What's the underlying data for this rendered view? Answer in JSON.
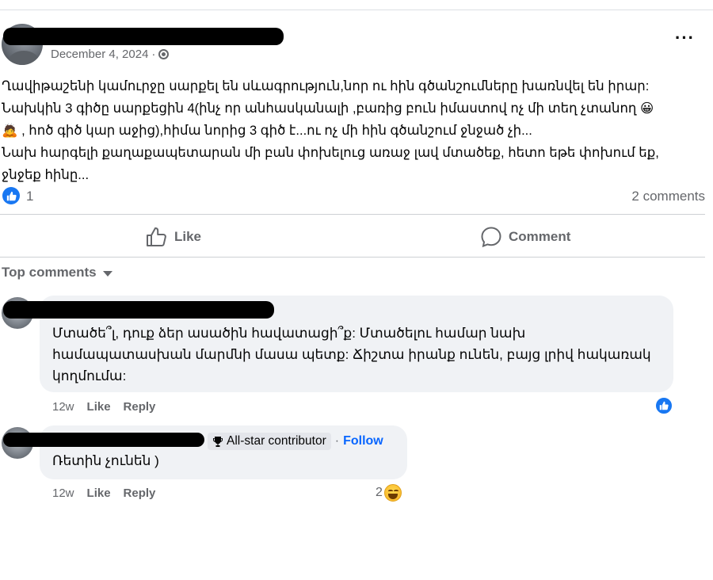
{
  "post": {
    "date": "December 4, 2024",
    "separator": "·",
    "audience_icon": "globe-icon",
    "more_icon": "ellipsis-icon",
    "text_lines": [
      "Ղավիթաշենի կամուրջը սարքել են սևագրություն,նոր ու հին գծանշումները խառնվել են իրար:",
      "Նախկին 3 գիծը սարքեցին 4(ինչ որ անհասկանալի ,բառից բուն իմաստով ոչ մի տեղ չտանող 😀",
      "🙇 , հոծ գիծ կար աջից),հիմա նորից 3 գիծ է...ու ոչ մի հին գծանշում ջնջած չի...",
      "Նախ հարգելի քաղաքապետարան մի բան փոխելուց առաջ լավ մտածեք, հետո եթե փոխում եք,",
      "ջնջեք հինը..."
    ],
    "reaction_count": "1",
    "comments_count": "2 comments"
  },
  "actions": {
    "like_label": "Like",
    "comment_label": "Comment"
  },
  "comments_section": {
    "sort_label": "Top comments",
    "comments": [
      {
        "text_lines": [
          "Մտածե՞լ, դուք ձեր ասածին հավատացի՞ք: Մտածելու համար նախ",
          "համապատասխան մարմնի մասա պետք: Ճիշտա իրանք ունեն, բայց լրիվ հակառակ",
          "կողմումա:"
        ],
        "time": "12w",
        "like_label": "Like",
        "reply_label": "Reply"
      },
      {
        "badge": "All-star contributor",
        "separator": "·",
        "follow_label": "Follow",
        "text": "Ռետին չունեն )",
        "time": "12w",
        "like_label": "Like",
        "reply_label": "Reply",
        "reaction_count": "2"
      }
    ]
  },
  "colors": {
    "accent": "#1877f2",
    "follow": "#0866ff",
    "secondary_text": "#65676b",
    "bubble": "#f0f2f5"
  }
}
